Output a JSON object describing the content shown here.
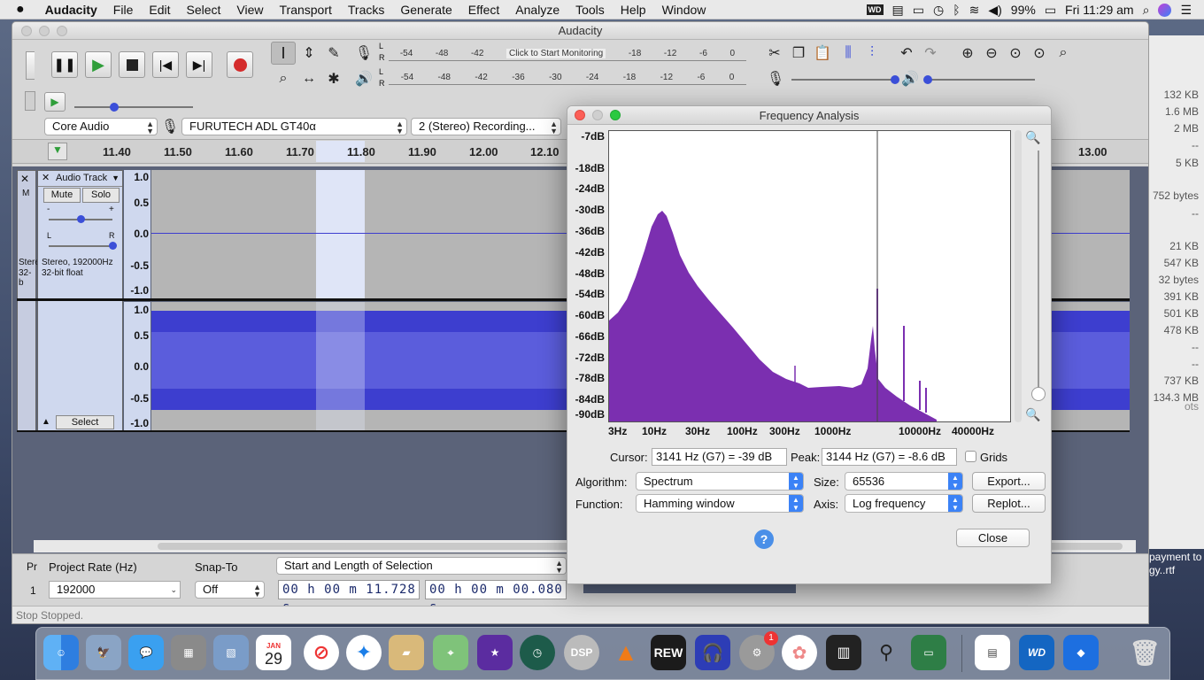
{
  "menubar": {
    "app": "Audacity",
    "items": [
      "File",
      "Edit",
      "Select",
      "View",
      "Transport",
      "Tracks",
      "Generate",
      "Effect",
      "Analyze",
      "Tools",
      "Help",
      "Window"
    ],
    "battery": "99%",
    "clock": "Fri 11:29 am"
  },
  "window": {
    "title": "Audacity"
  },
  "meter": {
    "record_ticks": [
      "-54",
      "-48",
      "-42",
      "Click to Start Monitoring",
      "-18",
      "-12",
      "-6",
      "0"
    ],
    "play_ticks": [
      "-54",
      "-48",
      "-42",
      "-36",
      "-30",
      "-24",
      "-18",
      "-12",
      "-6",
      "0"
    ],
    "lr": [
      "L",
      "R"
    ]
  },
  "device": {
    "host": "Core Audio",
    "input": "FURUTECH ADL GT40α",
    "channels": "2 (Stereo) Recording..."
  },
  "ruler": {
    "ticks": [
      "11.40",
      "11.50",
      "11.60",
      "11.70",
      "11.80",
      "11.90",
      "12.00",
      "12.10",
      "13.00"
    ]
  },
  "track": {
    "name": "Audio Track",
    "mute": "Mute",
    "solo": "Solo",
    "info1": "Stereo, 192000Hz",
    "info2": "32-bit float",
    "select": "Select",
    "gain_l": "-",
    "gain_r": "+",
    "pan_l": "L",
    "pan_r": "R",
    "partial_info1": "Stere",
    "partial_info2": "32-b",
    "partial_m": "M",
    "yaxis_top": [
      "1.0",
      "0.5",
      "0.0",
      "-0.5",
      "-1.0"
    ],
    "yaxis_bottom": [
      "1.0",
      "0.5",
      "0.0",
      "-0.5",
      "-1.0"
    ]
  },
  "bottom": {
    "rate_label": "Project Rate (Hz)",
    "snap_label": "Snap-To",
    "selection_label": "Start and Length of Selection",
    "rate_value": "192000",
    "snap_value": "Off",
    "start_time": "00 h 00 m 11.728 s",
    "length_time": "00 h 00 m 00.080 s",
    "partial_pr": "Pr",
    "partial_1": "1",
    "status": "Stopped.",
    "status_partial": "Stop"
  },
  "finder": {
    "sizes": [
      "132 KB",
      "1.6 MB",
      "2 MB",
      "--",
      "5 KB",
      "752 bytes",
      "--",
      "21 KB",
      "547 KB",
      "32 bytes",
      "391 KB",
      "501 KB",
      "478 KB",
      "--",
      "--",
      "737 KB",
      "134.3 MB"
    ],
    "file_a": "payment to",
    "file_b": "gy..rtf",
    "partial_s": "ots"
  },
  "freq": {
    "title": "Frequency Analysis",
    "db_labels": [
      "-7dB",
      "-18dB",
      "-24dB",
      "-30dB",
      "-36dB",
      "-42dB",
      "-48dB",
      "-54dB",
      "-60dB",
      "-66dB",
      "-72dB",
      "-78dB",
      "-84dB",
      "-90dB"
    ],
    "hz_labels": [
      "3Hz",
      "10Hz",
      "30Hz",
      "100Hz",
      "300Hz",
      "1000Hz",
      "10000Hz",
      "40000Hz"
    ],
    "cursor_label": "Cursor:",
    "cursor_value": "3141 Hz (G7) = -39 dB",
    "peak_label": "Peak:",
    "peak_value": "3144 Hz (G7) = -8.6 dB",
    "grids_label": "Grids",
    "algorithm_label": "Algorithm:",
    "algorithm_value": "Spectrum",
    "size_label": "Size:",
    "size_value": "65536",
    "export_label": "Export...",
    "function_label": "Function:",
    "function_value": "Hamming window",
    "axis_label": "Axis:",
    "axis_value": "Log frequency",
    "replot_label": "Replot...",
    "help_label": "?",
    "close_label": "Close"
  },
  "dock": {
    "calendar_month": "JAN",
    "calendar_day": "29",
    "badge": "1",
    "rew": "REW",
    "dsp": "DSP",
    "wd": "WD"
  },
  "colors": {
    "spectrum": "#7b2fb0",
    "waveform": "#3d3ecf",
    "accent": "#3b82f6"
  }
}
